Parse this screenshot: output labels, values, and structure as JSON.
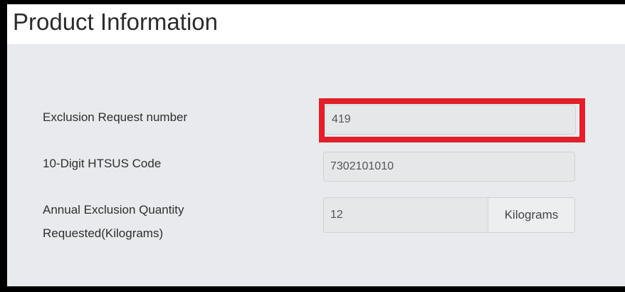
{
  "section": {
    "title": "Product Information"
  },
  "fields": {
    "exclusion_request": {
      "label": "Exclusion Request number",
      "value": "419"
    },
    "htsus_code": {
      "label": "10-Digit HTSUS Code",
      "value": "7302101010"
    },
    "annual_quantity": {
      "label_line1": "Annual Exclusion Quantity",
      "label_line2": "Requested(Kilograms)",
      "value": "12",
      "unit": "Kilograms"
    }
  },
  "colors": {
    "highlight": "#e0202a",
    "panel": "#e8eaed"
  }
}
